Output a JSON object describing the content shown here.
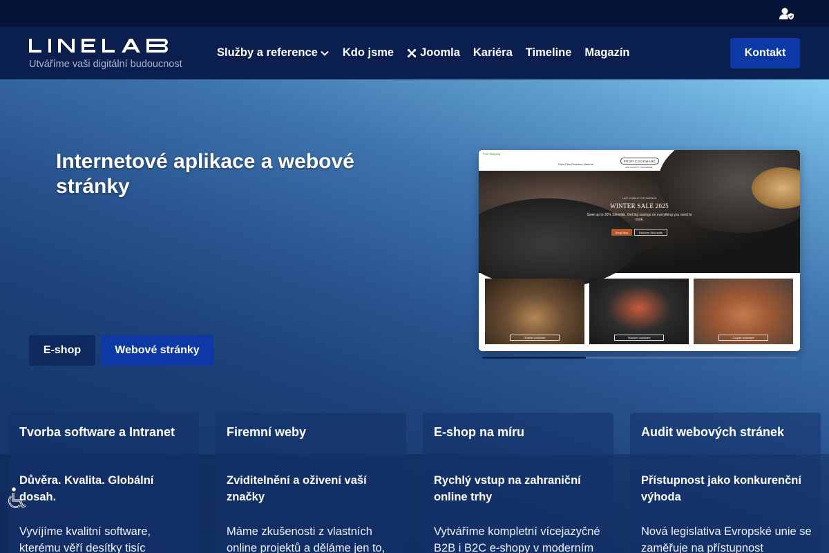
{
  "header": {
    "logo_text": "LINELAB",
    "tagline": "Utváříme vaši digitální budoucnost",
    "nav": [
      {
        "label": "Služby a reference"
      },
      {
        "label": "Kdo jsme"
      },
      {
        "label": "Joomla"
      },
      {
        "label": "Kariéra"
      },
      {
        "label": "Timeline"
      },
      {
        "label": "Magazín"
      }
    ],
    "contact_label": "Kontakt"
  },
  "topbar": {
    "icon": "user-lock-icon"
  },
  "hero": {
    "title": "Internetové aplikace a webové stránky",
    "tabs": [
      {
        "label": "E-shop"
      },
      {
        "label": "Webové stránky"
      }
    ],
    "slider_progress": 0.33,
    "screenshot": {
      "brand": "PROFICOOKWARE",
      "brand_sub": "HIGH QUALITY COOKWARE",
      "free_shipping": "Free Shipping",
      "menu_left": "Pans   Pots   Roasters   Material",
      "menu_right": "Fondue   Coffee and Tea   Lids   Cutlery",
      "sale_kicker": "LAST CHANCE FOR SAVINGS",
      "sale_title": "WINTER SALE 2025",
      "sale_desc": "Save up to 30% Sitewide. Get big savings on everything you need to cook.",
      "shop_now": "Shop Now",
      "discover": "Discover Discounts",
      "products": [
        "Granite cookware",
        "Titanium cookware",
        "Copper cookware"
      ]
    }
  },
  "cards": [
    {
      "title": "Tvorba software a Intranet",
      "subtitle": "Důvěra. Kvalita. Globální dosah.",
      "text": "Vyvíjíme kvalitní software, kterému věří desítky tisíc"
    },
    {
      "title": "Firemní weby",
      "subtitle": "Zviditelnění a oživení vaší značky",
      "text": "Máme zkušenosti z vlastních online projektů a děláme jen to,"
    },
    {
      "title": "E-shop na míru",
      "subtitle": "Rychlý vstup na zahraniční online trhy",
      "text": "Vytváříme kompletní vícejazyčné B2B i B2C e-shopy v moderním"
    },
    {
      "title": "Audit webových stránek",
      "subtitle": "Přístupnost jako konkurenční výhoda",
      "text": "Nová legislativa Evropské unie se zaměřuje na přístupnost"
    }
  ],
  "colors": {
    "navy": "#0a1f4e",
    "accent_blue": "#0d39a6",
    "dark_tab": "#0f2a5e"
  }
}
